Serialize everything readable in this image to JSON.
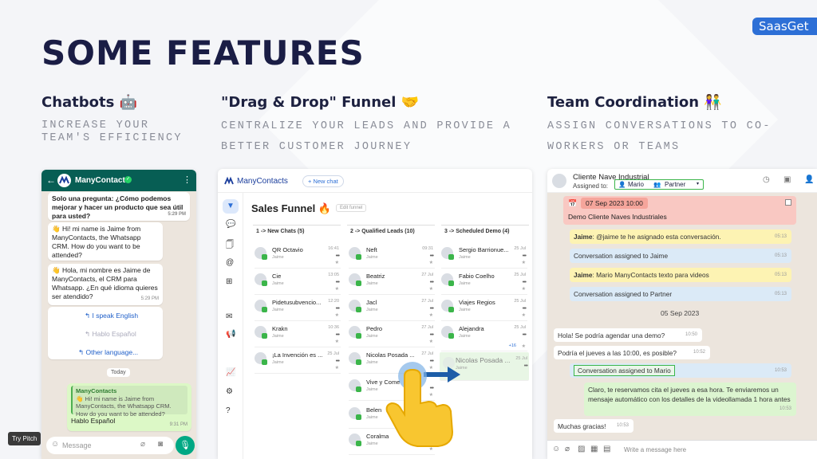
{
  "brand": "SaasGet",
  "title": "SOME FEATURES",
  "try_pitch": "Try Pitch",
  "features": [
    {
      "title": "Chatbots 🤖",
      "subtitle": "INCREASE YOUR TEAM'S EFFICIENCY"
    },
    {
      "title": "\"Drag & Drop\" Funnel 🤝",
      "subtitle": "CENTRALIZE YOUR LEADS AND PROVIDE A BETTER CUSTOMER JOURNEY"
    },
    {
      "title": "Team Coordination 👫",
      "subtitle": "ASSIGN CONVERSATIONS TO CO-WORKERS OR TEAMS"
    }
  ],
  "chatbot": {
    "header_name": "ManyContacts",
    "msg1": "Solo una pregunta: ¿Cómo podemos mejorar y hacer un producto que sea útil para usted?",
    "msg1_time": "5:29 PM",
    "msg2": "👋 Hi! mi name is Jaime from ManyContacts, the Whatsapp CRM. How do you want to be attended?",
    "msg3": "👋 Hola, mi nombre es Jaime de ManyContacts, el CRM para Whatsapp. ¿En qué idioma quieres ser atendido?",
    "msg3_time": "5:29 PM",
    "opt1": "↰ I speak English",
    "opt2": "↰ Hablo Español",
    "opt3": "↰ Other language...",
    "today": "Today",
    "reply_author": "ManyContacts",
    "reply_quote": "👋 Hi! mi name is Jaime from ManyContacts, the Whatsapp CRM. How do you want to be attended?",
    "reply_text": "Hablo Español",
    "reply_time": "9:31 PM",
    "input_placeholder": "Message"
  },
  "funnel": {
    "app_name": "ManyContacts",
    "new_chat": "+ New chat",
    "title": "Sales Funnel 🔥",
    "edit": "Edit funnel",
    "columns": [
      {
        "header": "1 -> New Chats (5)",
        "cards": [
          {
            "name": "QR Octavio",
            "sub": "Jaime",
            "date": "16:41"
          },
          {
            "name": "Cie",
            "sub": "Jaime",
            "date": "13:05"
          },
          {
            "name": "Pidetusubvencio...",
            "sub": "Jaime",
            "date": "12:20"
          },
          {
            "name": "Krakn",
            "sub": "Jaime",
            "date": "10:36"
          },
          {
            "name": "¡La Invención es ...",
            "sub": "Jaime",
            "date": "25 Jul"
          }
        ]
      },
      {
        "header": "2 -> Qualified Leads (10)",
        "cards": [
          {
            "name": "Neft",
            "sub": "Jaime",
            "date": "09:31"
          },
          {
            "name": "Beatriz",
            "sub": "Jaime",
            "date": "27 Jul"
          },
          {
            "name": "Jacl",
            "sub": "Jaime",
            "date": "27 Jul"
          },
          {
            "name": "Pedro",
            "sub": "Jaime",
            "date": "27 Jul"
          },
          {
            "name": "Nicolas Posada ...",
            "sub": "Jaime",
            "date": "27 Jul"
          },
          {
            "name": "Vive y Come",
            "sub": "Jaime",
            "date": ""
          },
          {
            "name": "Belen",
            "sub": "Jaime",
            "date": ""
          },
          {
            "name": "Coralma",
            "sub": "Jaime",
            "date": ""
          }
        ]
      },
      {
        "header": "3 -> Scheduled Demo (4)",
        "cards": [
          {
            "name": "Sergio Barrionue...",
            "sub": "Jaime",
            "date": "25 Jul"
          },
          {
            "name": "Fabio Coelho",
            "sub": "Jaime",
            "date": "25 Jul"
          },
          {
            "name": "Viajes Regios",
            "sub": "Jaime",
            "date": "25 Jul"
          },
          {
            "name": "Alejandra",
            "sub": "Jaime",
            "date": "25 Jul"
          }
        ]
      }
    ],
    "dragging": {
      "name": "Nicolas Posada ...",
      "sub": "Jaime",
      "date": "25 Jul"
    },
    "badge": "+16"
  },
  "team": {
    "contact": "Cliente Nave Industrial",
    "assigned_to": "Assigned to:",
    "assignee": "Mario",
    "team": "Partner",
    "date_label": "07 Sep 2023 10:00",
    "event": "Demo Cliente Naves Industriales",
    "messages": [
      {
        "author": "Jaime",
        "text": ": @jaime te he asignado esta conversación.",
        "time": "05:13",
        "style": "yellow"
      },
      {
        "author": "",
        "text": "Conversation assigned to Jaime",
        "time": "05:13",
        "style": "blue"
      },
      {
        "author": "Jaime",
        "text": ": Mario ManyContacts texto para videos",
        "time": "05:13",
        "style": "yellow"
      },
      {
        "author": "",
        "text": "Conversation assigned to Partner",
        "time": "05:13",
        "style": "blue"
      }
    ],
    "day": "05 Sep 2023",
    "msg_in1": "Hola! Se podría agendar una demo?",
    "msg_in1_time": "10:50",
    "msg_in2": "Podría el jueves a las 10:00, es posible?",
    "msg_in2_time": "10:52",
    "assigned_mario": "Conversation assigned to Mario",
    "assigned_mario_time": "10:53",
    "msg_out": "Claro, te reservamos cita el jueves a esa hora. Te enviaremos un mensaje automático con los detalles de la videollamada 1 hora antes",
    "msg_out_time": "10:53",
    "msg_in3": "Muchas gracias!",
    "msg_in3_time": "10:53",
    "input_placeholder": "Write a message here"
  }
}
